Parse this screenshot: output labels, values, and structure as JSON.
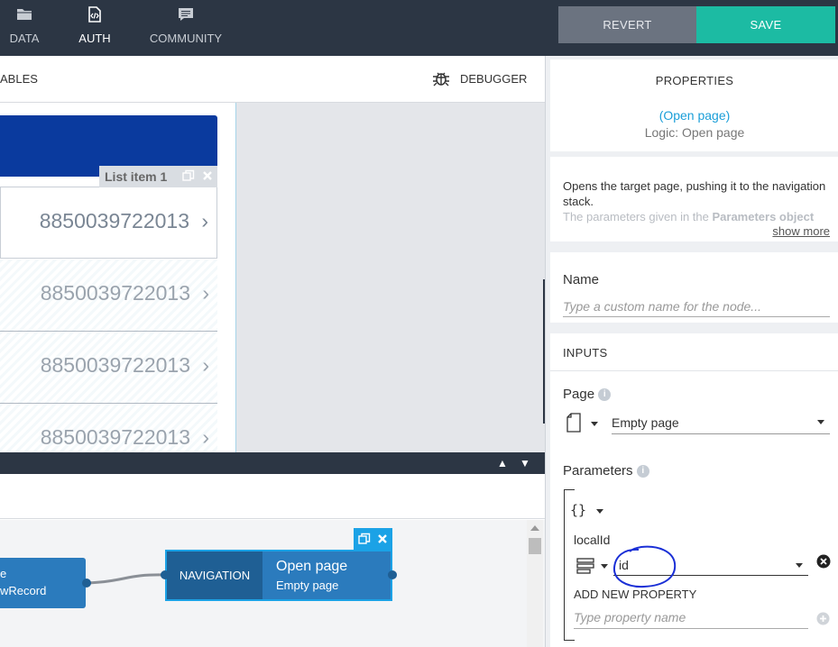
{
  "nav": {
    "data_label": "DATA",
    "auth_label": "AUTH",
    "community_label": "COMMUNITY"
  },
  "actions": {
    "revert_label": "REVERT",
    "save_label": "SAVE"
  },
  "canvas": {
    "variables_label": "ABLES",
    "debugger_label": "DEBUGGER"
  },
  "preview": {
    "list_tag_label": "List item 1",
    "rows": [
      "8850039722013",
      "8850039722013",
      "8850039722013",
      "8850039722013"
    ]
  },
  "logic": {
    "prev_node_line1": "e",
    "prev_node_line2": "wRecord",
    "nav_node_category": "NAVIGATION",
    "nav_node_title": "Open page",
    "nav_node_subtitle": "Empty page"
  },
  "properties": {
    "title": "PROPERTIES",
    "node_link": "(Open page)",
    "node_logic": "Logic: Open page",
    "description": "Opens the target page, pushing it to the navigation stack.",
    "description_faded_prefix": "The parameters given in the ",
    "description_faded_bold": "Parameters object",
    "show_more": "show more",
    "name_label": "Name",
    "name_placeholder": "Type a custom name for the node...",
    "inputs_label": "INPUTS",
    "page_label": "Page",
    "page_value": "Empty page",
    "parameters_label": "Parameters",
    "param_key": "localId",
    "param_value": "id",
    "add_property_label": "ADD NEW PROPERTY",
    "add_property_placeholder": "Type property name"
  },
  "colors": {
    "topbar": "#2c3644",
    "accent": "#1cbba3",
    "link": "#1a9ed8",
    "list_header": "#0a3a9e",
    "node": "#2b7bbd",
    "annotation": "#1a2fd6"
  }
}
